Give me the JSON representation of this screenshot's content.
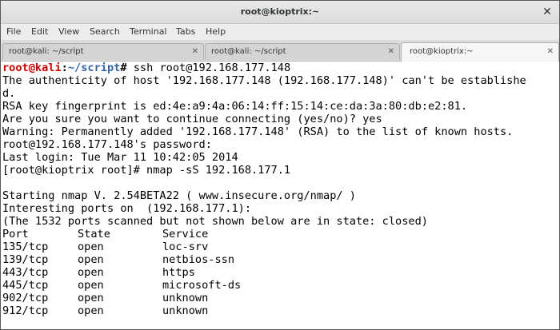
{
  "window": {
    "title": "root@kioptrix:~",
    "close_glyph": "✕"
  },
  "menu": [
    "File",
    "Edit",
    "View",
    "Search",
    "Terminal",
    "Tabs",
    "Help"
  ],
  "tabs": [
    {
      "label": "root@kali: ~/script",
      "active": false
    },
    {
      "label": "root@kali: ~/script",
      "active": false
    },
    {
      "label": "root@kioptrix:~",
      "active": true
    }
  ],
  "tab_close_glyph": "✕",
  "terminal": {
    "prompt": {
      "user_host": "root@kali",
      "colon": ":",
      "path": "~/script",
      "symbol": "#",
      "command": " ssh root@192.168.177.148"
    },
    "lines": [
      "The authenticity of host '192.168.177.148 (192.168.177.148)' can't be establishe",
      "d.",
      "RSA key fingerprint is ed:4e:a9:4a:06:14:ff:15:14:ce:da:3a:80:db:e2:81.",
      "Are you sure you want to continue connecting (yes/no)? yes",
      "Warning: Permanently added '192.168.177.148' (RSA) to the list of known hosts.",
      "root@192.168.177.148's password:",
      "Last login: Tue Mar 11 10:42:05 2014",
      "[root@kioptrix root]# nmap -sS 192.168.177.1",
      "",
      "Starting nmap V. 2.54BETA22 ( www.insecure.org/nmap/ )",
      "Interesting ports on  (192.168.177.1):",
      "(The 1532 ports scanned but not shown below are in state: closed)"
    ],
    "ports_header": [
      "Port",
      "State",
      "Service"
    ],
    "ports": [
      [
        "135/tcp",
        "open",
        "loc-srv"
      ],
      [
        "139/tcp",
        "open",
        "netbios-ssn"
      ],
      [
        "443/tcp",
        "open",
        "https"
      ],
      [
        "445/tcp",
        "open",
        "microsoft-ds"
      ],
      [
        "902/tcp",
        "open",
        "unknown"
      ],
      [
        "912/tcp",
        "open",
        "unknown"
      ]
    ]
  },
  "colors": {
    "prompt_user": "#cc0000",
    "prompt_path": "#3465a4",
    "terminal_bg": "#ffffff",
    "terminal_fg": "#000000"
  }
}
